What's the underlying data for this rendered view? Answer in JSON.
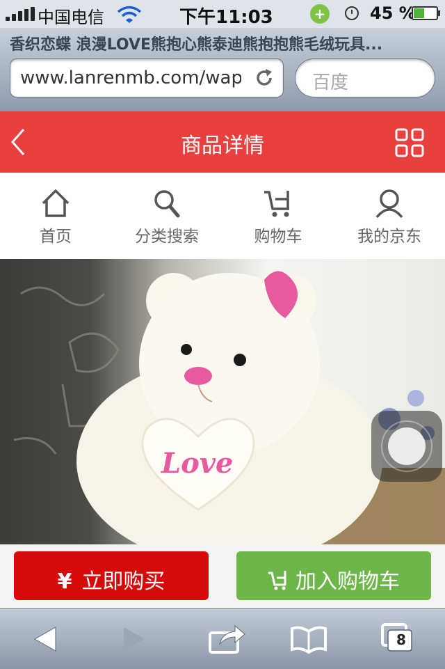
{
  "status_bar": {
    "carrier": "中国电信",
    "time": "下午11:03",
    "battery": "45 %",
    "battery_level": 0.45
  },
  "browser": {
    "page_title": "香织恋蝶 浪漫LOVE熊抱心熊泰迪熊抱抱熊毛绒玩具...",
    "url": "www.lanrenmb.com/wap",
    "search_placeholder": "百度",
    "tabs_count": "8"
  },
  "header": {
    "title": "商品详情"
  },
  "nav": {
    "items": [
      {
        "label": "首页",
        "icon": "home-icon"
      },
      {
        "label": "分类搜索",
        "icon": "search-icon"
      },
      {
        "label": "购物车",
        "icon": "cart-icon"
      },
      {
        "label": "我的京东",
        "icon": "user-icon"
      }
    ]
  },
  "product": {
    "heart_text": "Love"
  },
  "actions": {
    "buy_icon": "¥",
    "buy_label": "立即购买",
    "cart_label": "加入购物车"
  },
  "colors": {
    "header_red": "#e8403e",
    "buy_red": "#d60a0a",
    "cart_green": "#6eb54a"
  }
}
